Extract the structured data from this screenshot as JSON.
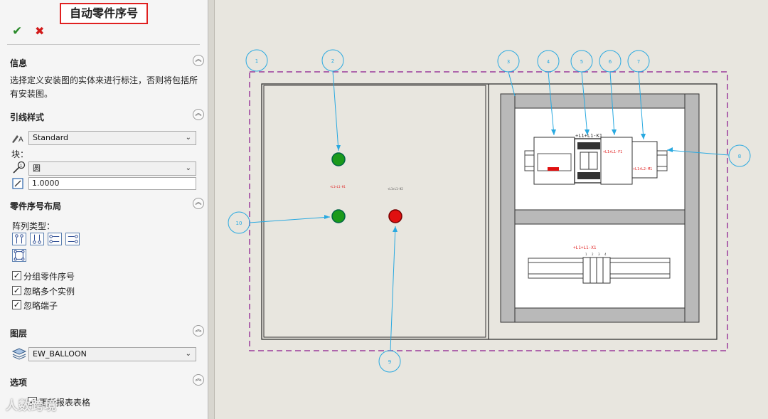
{
  "panel": {
    "title": "自动零件序号",
    "ok_icon": "check-icon",
    "cancel_icon": "close-icon",
    "sections": {
      "info": {
        "title": "信息",
        "text": "选择定义安装图的实体来进行标注，否则将包括所有安装图。"
      },
      "leader_style": {
        "title": "引线样式",
        "style_value": "Standard",
        "block_label": "块：",
        "block_value": "圆",
        "size_value": "1.0000"
      },
      "layout": {
        "title": "零件序号布局",
        "pattern_label": "阵列类型：",
        "checks": [
          {
            "label": "分组零件序号",
            "checked": true
          },
          {
            "label": "忽略多个实例",
            "checked": true
          },
          {
            "label": "忽略端子",
            "checked": true
          }
        ]
      },
      "layer": {
        "title": "图层",
        "value": "EW_BALLOON"
      },
      "options": {
        "title": "选项",
        "check_label": "更新报表表格",
        "checked": true
      }
    }
  },
  "watermark": "人数跨境",
  "drawing": {
    "balloons": [
      "1",
      "2",
      "3",
      "4",
      "5",
      "6",
      "7",
      "8",
      "9",
      "10"
    ],
    "tags": {
      "top_left_lamp": "+L1+L1-H1",
      "top_right_lamp": "+L1+L1-H2",
      "contactor": "+L1+L1-K1",
      "breaker": "+L1+L1-F1",
      "relay": "+L1+L2-M1",
      "terminal": "+L1+L1-X1",
      "terminal_numbers": [
        "1",
        "2",
        "3",
        "4"
      ]
    },
    "colors": {
      "balloon": "#29a9e0",
      "boundary": "#9b3b9b",
      "lamp_green": "#1b9a1b",
      "lamp_red": "#e01010",
      "label_red": "#e02020"
    }
  }
}
